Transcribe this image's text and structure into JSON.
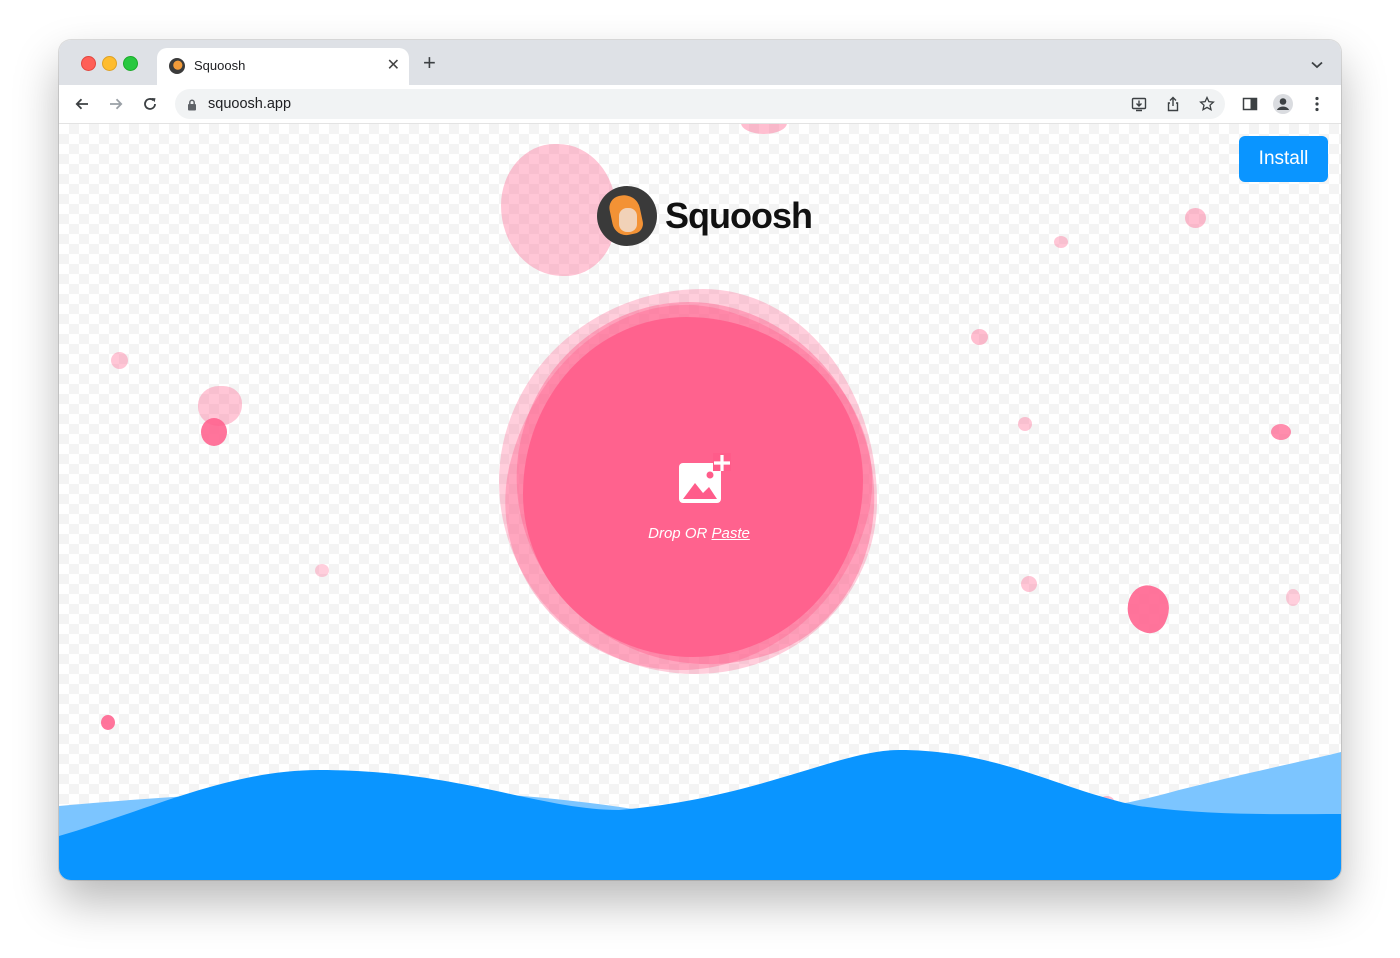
{
  "browser": {
    "tab": {
      "title": "Squoosh"
    },
    "address_bar": {
      "url": "squoosh.app"
    }
  },
  "page": {
    "logo_text": "Squoosh",
    "install_button": "Install",
    "drop_zone": {
      "text_before": "Drop OR ",
      "paste_link": "Paste"
    }
  },
  "colors": {
    "accent_blue": "#0a95ff",
    "blob_pink": "#ff5c8a",
    "wave_light": "#7cc5ff"
  }
}
